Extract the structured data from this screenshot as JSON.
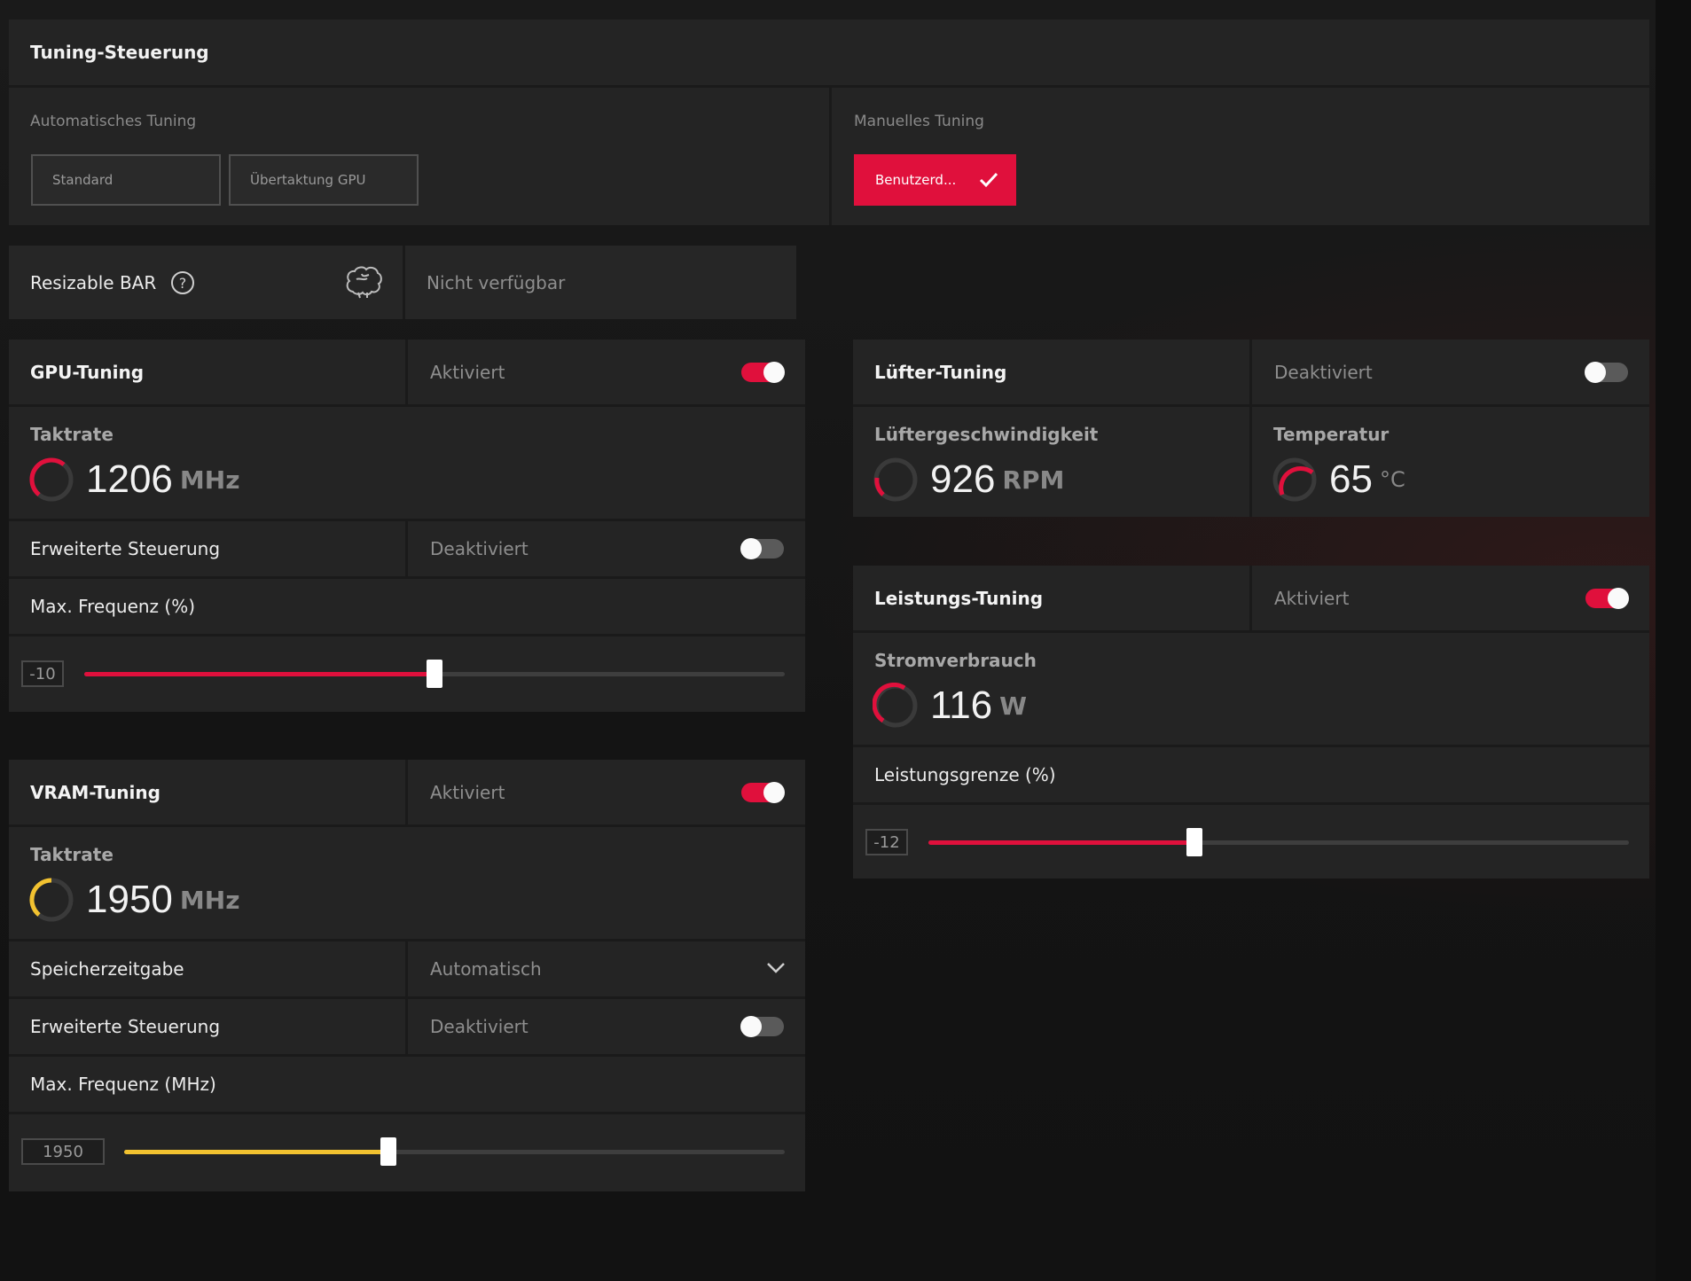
{
  "tuning_control": {
    "title": "Tuning-Steuerung",
    "auto_label": "Automatisches Tuning",
    "auto_buttons": [
      "Standard",
      "Übertaktung GPU"
    ],
    "manual_label": "Manuelles Tuning",
    "manual_button": "Benutzerd...",
    "accent": "#e0103c"
  },
  "resizable_bar": {
    "label": "Resizable BAR",
    "status": "Nicht verfügbar"
  },
  "gpu_tuning": {
    "title": "GPU-Tuning",
    "status": "Aktiviert",
    "enabled": true,
    "clock_label": "Taktrate",
    "clock_value": "1206",
    "clock_unit": "MHz",
    "advanced_label": "Erweiterte Steuerung",
    "advanced_status": "Deaktiviert",
    "advanced_enabled": false,
    "freq_label": "Max. Frequenz (%)",
    "slider_value": "-10",
    "slider_fraction": 0.5,
    "slider_color": "#e0103c"
  },
  "vram_tuning": {
    "title": "VRAM-Tuning",
    "status": "Aktiviert",
    "enabled": true,
    "clock_label": "Taktrate",
    "clock_value": "1950",
    "clock_unit": "MHz",
    "timing_label": "Speicherzeitgabe",
    "timing_value": "Automatisch",
    "advanced_label": "Erweiterte Steuerung",
    "advanced_status": "Deaktiviert",
    "advanced_enabled": false,
    "freq_label": "Max. Frequenz (MHz)",
    "slider_value": "1950",
    "slider_fraction": 0.4,
    "slider_color": "#f2c230"
  },
  "fan_tuning": {
    "title": "Lüfter-Tuning",
    "status": "Deaktiviert",
    "enabled": false,
    "speed_label": "Lüftergeschwindigkeit",
    "speed_value": "926",
    "speed_unit": "RPM",
    "temp_label": "Temperatur",
    "temp_value": "65",
    "temp_unit": "°C"
  },
  "power_tuning": {
    "title": "Leistungs-Tuning",
    "status": "Aktiviert",
    "enabled": true,
    "power_label": "Stromverbrauch",
    "power_value": "116",
    "power_unit": "W",
    "limit_label": "Leistungsgrenze (%)",
    "slider_value": "-12",
    "slider_fraction": 0.38,
    "slider_color": "#e0103c"
  }
}
